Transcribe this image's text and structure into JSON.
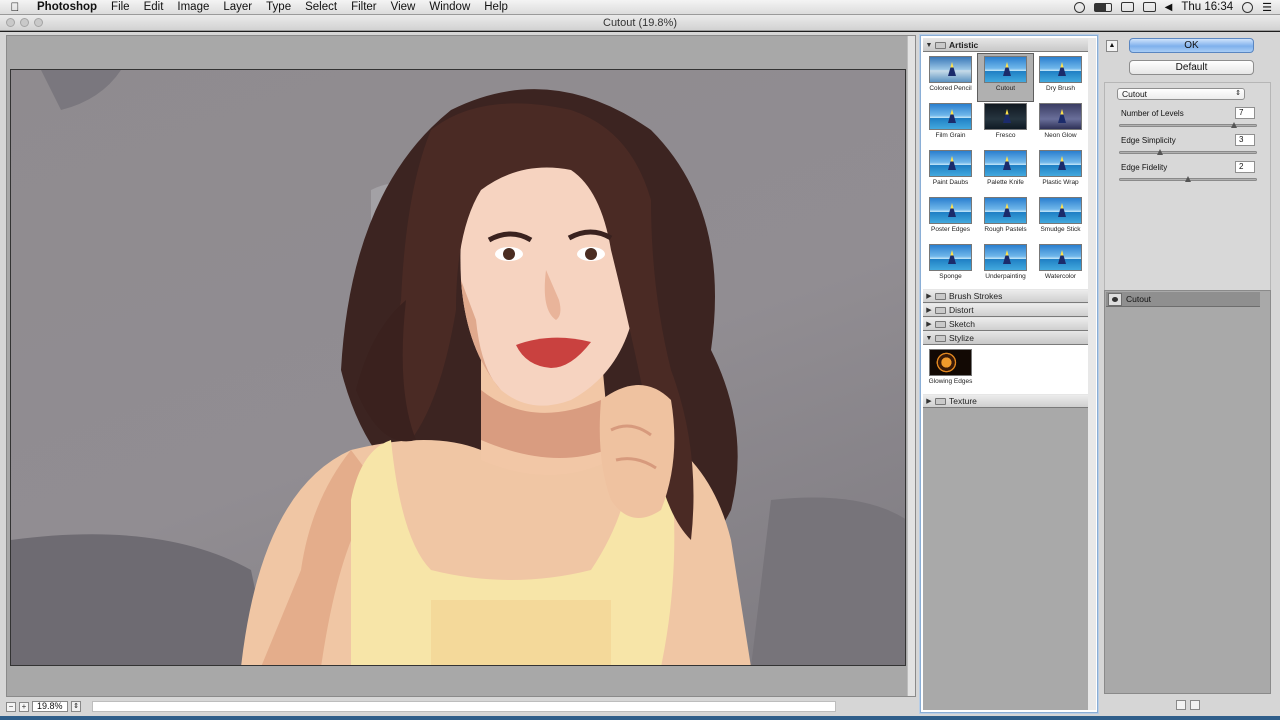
{
  "menubar": {
    "apple_icon": "apple-icon",
    "app_name": "Photoshop",
    "menus": [
      "File",
      "Edit",
      "Image",
      "Layer",
      "Type",
      "Select",
      "Filter",
      "View",
      "Window",
      "Help"
    ],
    "status_icons": [
      "adobe-icon",
      "keyboard-icon",
      "display-icon",
      "airplay-icon",
      "volume-icon"
    ],
    "clock": "Thu 16:34",
    "search_icon": "search-icon",
    "list_icon": "list-icon"
  },
  "window": {
    "title": "Cutout (19.8%)"
  },
  "statusbar": {
    "zoom_out": "−",
    "zoom_in": "+",
    "zoom": "19.8%",
    "zoom_dropdown": "⇕"
  },
  "gallery": {
    "categories": [
      {
        "label": "Artistic",
        "open": true,
        "filters": [
          "Colored Pencil",
          "Cutout",
          "Dry Brush",
          "Film Grain",
          "Fresco",
          "Neon Glow",
          "Paint Daubs",
          "Palette Knife",
          "Plastic Wrap",
          "Poster Edges",
          "Rough Pastels",
          "Smudge Stick",
          "Sponge",
          "Underpainting",
          "Watercolor"
        ]
      },
      {
        "label": "Brush Strokes",
        "open": false
      },
      {
        "label": "Distort",
        "open": false
      },
      {
        "label": "Sketch",
        "open": false
      },
      {
        "label": "Stylize",
        "open": true,
        "filters": [
          "Glowing Edges"
        ]
      },
      {
        "label": "Texture",
        "open": false
      }
    ],
    "selected_filter": "Cutout"
  },
  "controls": {
    "toggle": "▲",
    "ok": "OK",
    "default": "Default",
    "filter_select": "Cutout",
    "filter_select_arrow": "⇕",
    "params": [
      {
        "label": "Number of Levels",
        "value": "7",
        "fraction": 0.83
      },
      {
        "label": "Edge Simplicity",
        "value": "3",
        "fraction": 0.3
      },
      {
        "label": "Edge Fidelity",
        "value": "2",
        "fraction": 0.5
      }
    ]
  },
  "layers": {
    "items": [
      {
        "name": "Cutout",
        "visible": true
      }
    ]
  }
}
